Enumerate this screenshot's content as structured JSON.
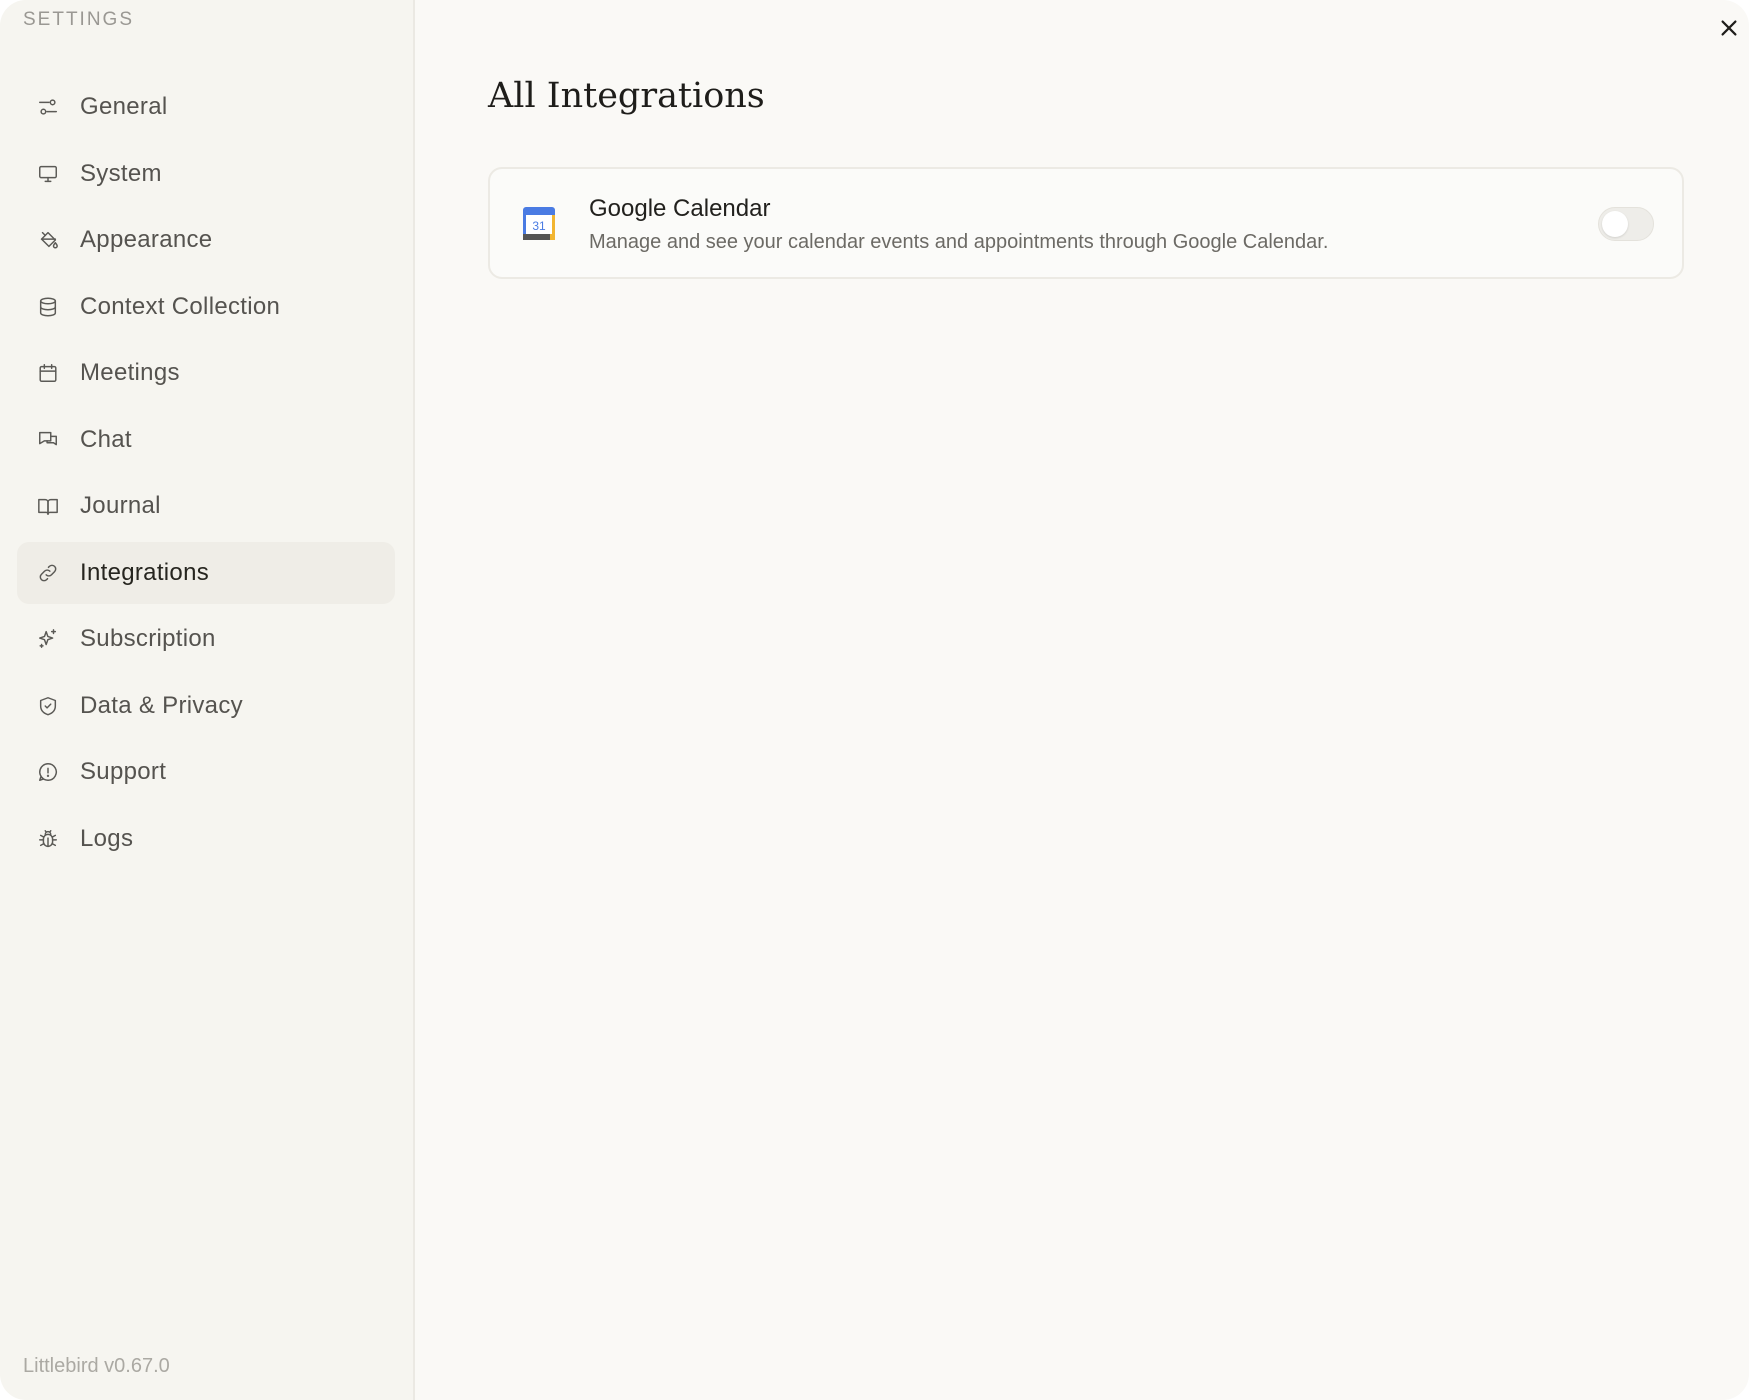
{
  "sidebar": {
    "heading": "SETTINGS",
    "version": "Littlebird v0.67.0",
    "items": [
      {
        "label": "General",
        "icon": "sliders-icon"
      },
      {
        "label": "System",
        "icon": "monitor-icon"
      },
      {
        "label": "Appearance",
        "icon": "paint-bucket-icon"
      },
      {
        "label": "Context Collection",
        "icon": "database-icon"
      },
      {
        "label": "Meetings",
        "icon": "calendar-icon"
      },
      {
        "label": "Chat",
        "icon": "chat-bubbles-icon"
      },
      {
        "label": "Journal",
        "icon": "book-open-icon"
      },
      {
        "label": "Integrations",
        "icon": "link-icon",
        "active": true
      },
      {
        "label": "Subscription",
        "icon": "sparkles-icon"
      },
      {
        "label": "Data & Privacy",
        "icon": "shield-icon"
      },
      {
        "label": "Support",
        "icon": "alert-bubble-icon"
      },
      {
        "label": "Logs",
        "icon": "bug-icon"
      }
    ]
  },
  "main": {
    "title": "All Integrations",
    "integrations": [
      {
        "name": "Google Calendar",
        "description": "Manage and see your calendar events and appointments through Google Calendar.",
        "icon": "google-calendar-icon",
        "icon_text": "31",
        "enabled": false
      }
    ]
  },
  "colors": {
    "background": "#faf9f6",
    "sidebar": "#f6f5f0",
    "active_item": "#efede7"
  }
}
